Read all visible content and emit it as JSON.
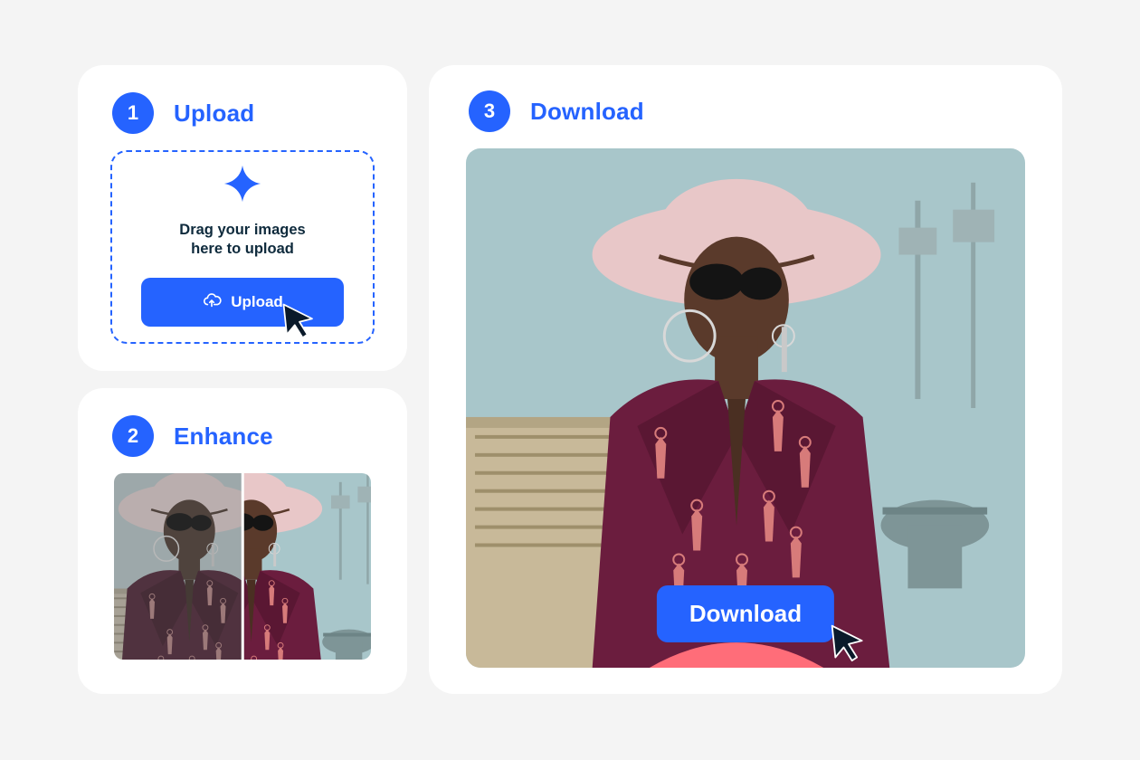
{
  "steps": {
    "upload": {
      "number": "1",
      "title": "Upload",
      "drop_line1": "Drag your images",
      "drop_line2": "here to upload",
      "button_label": "Upload"
    },
    "enhance": {
      "number": "2",
      "title": "Enhance"
    },
    "download": {
      "number": "3",
      "title": "Download",
      "button_label": "Download"
    }
  }
}
